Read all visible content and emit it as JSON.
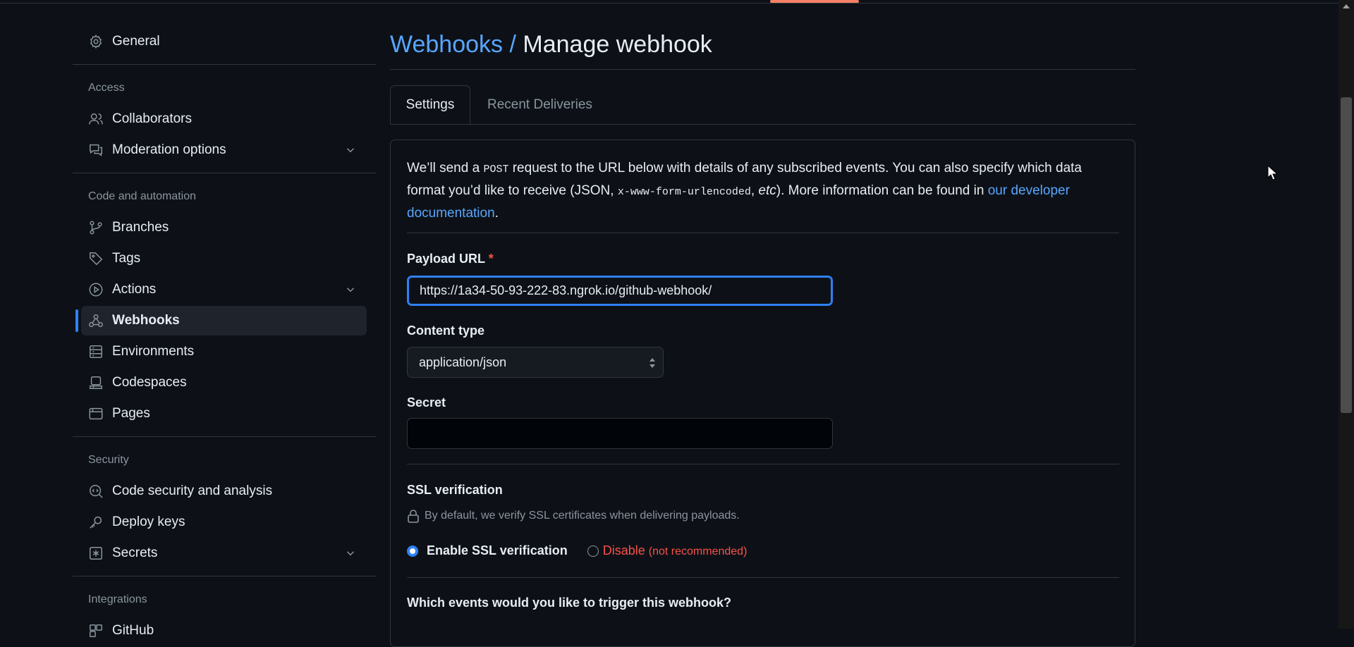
{
  "sidebar": {
    "general": "General",
    "sections": {
      "access": "Access",
      "code_automation": "Code and automation",
      "security": "Security",
      "integrations": "Integrations"
    },
    "items": {
      "collaborators": "Collaborators",
      "moderation": "Moderation options",
      "branches": "Branches",
      "tags": "Tags",
      "actions": "Actions",
      "webhooks": "Webhooks",
      "environments": "Environments",
      "codespaces": "Codespaces",
      "pages": "Pages",
      "code_security": "Code security and analysis",
      "deploy_keys": "Deploy keys",
      "secrets": "Secrets",
      "github_apps_partial": "GitHub"
    },
    "active": "Webhooks"
  },
  "header": {
    "breadcrumb": "Webhooks",
    "separator": "/",
    "title": "Manage webhook"
  },
  "tabs": [
    {
      "label": "Settings",
      "active": true
    },
    {
      "label": "Recent Deliveries",
      "active": false
    }
  ],
  "intro": {
    "part1": "We’ll send a ",
    "post": "POST",
    "part2": " request to the URL below with details of any subscribed events. You can also specify which data format you’d like to receive (JSON, ",
    "form": "x-www-form-urlencoded",
    "part3": ", ",
    "etc": "etc",
    "part4": "). More information can be found in ",
    "link": "our developer documentation",
    "part5": "."
  },
  "form": {
    "payload_url_label": "Payload URL",
    "required_mark": "*",
    "payload_url_value": "https://1a34-50-93-222-83.ngrok.io/github-webhook/",
    "content_type_label": "Content type",
    "content_type_value": "application/json",
    "secret_label": "Secret",
    "secret_value": "",
    "ssl_label": "SSL verification",
    "ssl_hint": "By default, we verify SSL certificates when delivering payloads.",
    "ssl_enable": "Enable SSL verification",
    "ssl_disable": "Disable",
    "ssl_disable_note": "(not recommended)",
    "ssl_selected": "enable",
    "events_question": "Which events would you like to trigger this webhook?"
  },
  "colors": {
    "background": "#0d1117",
    "accent": "#2f81f7",
    "link": "#58a6ff",
    "danger": "#f85149",
    "tab_underline": "#f78166"
  }
}
